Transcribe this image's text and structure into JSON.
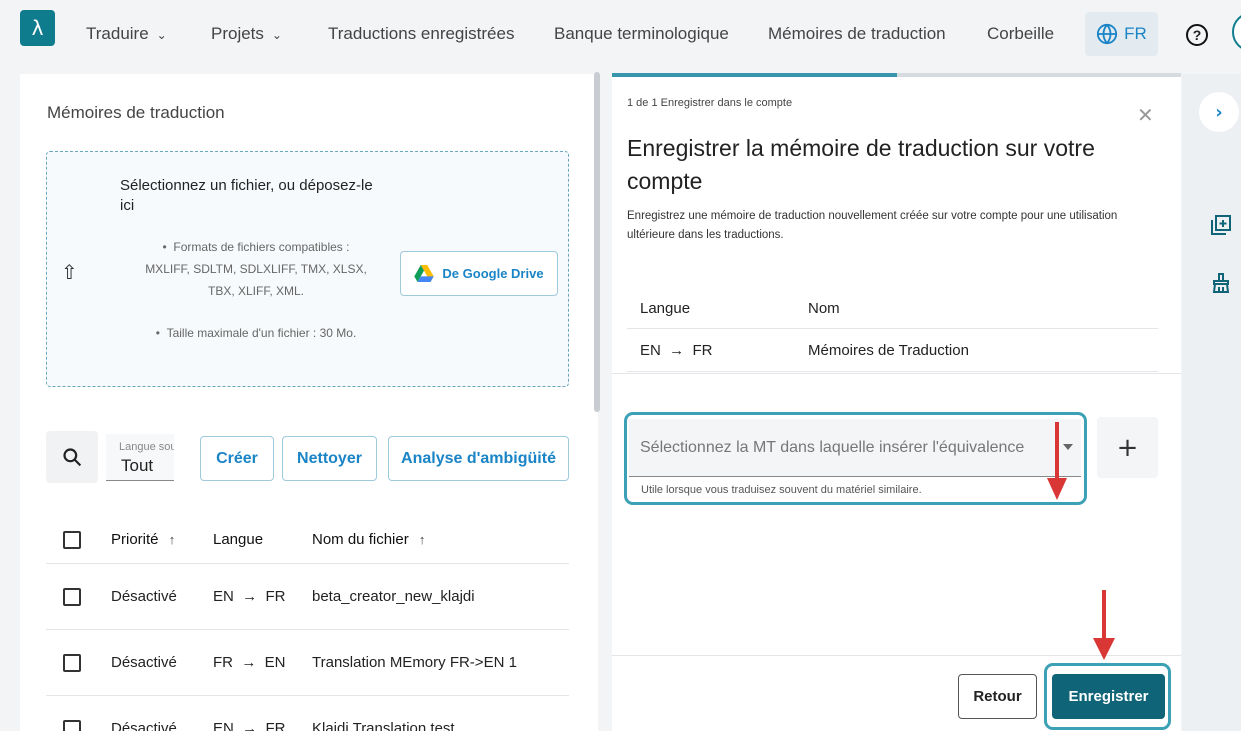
{
  "nav": {
    "logo": "λ",
    "items": [
      {
        "label": "Traduire",
        "dropdown": true
      },
      {
        "label": "Projets",
        "dropdown": true
      },
      {
        "label": "Traductions enregistrées",
        "dropdown": false
      },
      {
        "label": "Banque terminologique",
        "dropdown": false
      },
      {
        "label": "Mémoires de traduction",
        "dropdown": false
      },
      {
        "label": "Corbeille",
        "dropdown": false
      }
    ],
    "language": "FR",
    "help": "?"
  },
  "left_panel": {
    "title": "Mémoires de traduction",
    "dropzone": {
      "title": "Sélectionnez un fichier, ou déposez-le ici",
      "formats": "Formats de fichiers compatibles : MXLIFF, SDLTM, SDLXLIFF, TMX, XLSX, TBX, XLIFF, XML.",
      "max_size": "Taille maximale d'un fichier : 30 Mo.",
      "gdrive_label": "De Google Drive"
    },
    "toolbar": {
      "lang_filter_label": "Langue source",
      "lang_filter_value": "Tout",
      "create": "Créer",
      "clean": "Nettoyer",
      "ambiguity": "Analyse d'ambigüité"
    },
    "table": {
      "headers": {
        "priority": "Priorité",
        "language": "Langue",
        "filename": "Nom du fichier"
      },
      "rows": [
        {
          "priority": "Désactivé",
          "src": "EN",
          "tgt": "FR",
          "filename": "beta_creator_new_klajdi"
        },
        {
          "priority": "Désactivé",
          "src": "FR",
          "tgt": "EN",
          "filename": "Translation MEmory FR->EN 1"
        },
        {
          "priority": "Désactivé",
          "src": "EN",
          "tgt": "FR",
          "filename": "Klajdi Translation test"
        }
      ]
    }
  },
  "modal": {
    "step": "1 de 1 Enregistrer dans le compte",
    "progress": 0.5,
    "title": "Enregistrer la mémoire de traduction sur votre compte",
    "description": "Enregistrez une mémoire de traduction nouvellement créée sur votre compte pour une utilisation ultérieure dans les traductions.",
    "table": {
      "headers": {
        "language": "Langue",
        "name": "Nom"
      },
      "rows": [
        {
          "src": "EN",
          "tgt": "FR",
          "name": "Mémoires de Traduction"
        }
      ]
    },
    "select_placeholder": "Sélectionnez la MT dans laquelle insérer l'équivalence",
    "helper": "Utile lorsque vous traduisez souvent du matériel similaire.",
    "add": "+",
    "back": "Retour",
    "save": "Enregistrer"
  },
  "colors": {
    "brand": "#0f7c8e",
    "accent_blue": "#1a84c6",
    "highlight": "#3da1b5",
    "arrow": "#d93636"
  }
}
